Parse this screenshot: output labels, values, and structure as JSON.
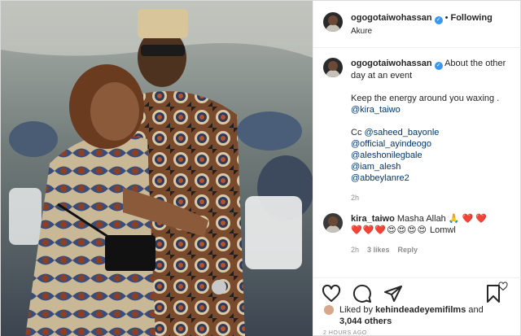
{
  "header": {
    "username": "ogogotaiwohassan",
    "separator": "•",
    "follow_label": "Following",
    "location": "Akure"
  },
  "caption": {
    "username": "ogogotaiwohassan",
    "line1": "About the other day at an event",
    "line2": "Keep the energy around you waxing .",
    "mention1": "@kira_taiwo",
    "cc_label": "Cc",
    "mentions": [
      "@saheed_bayonle",
      "@official_ayindeogo",
      "@aleshonilegbale",
      "@iam_alesh",
      "@abbeylanre2"
    ],
    "time": "2h"
  },
  "comment": {
    "username": "kira_taiwo",
    "text": "Masha Allah 🙏 ❤️ ❤️",
    "emoji_line": "❤️❤️❤️😍😍😍😍",
    "tail": "Lomwl",
    "time": "2h",
    "likes": "3 likes",
    "reply": "Reply"
  },
  "likes": {
    "prefix": "Liked by",
    "user": "kehindeadeyemifilms",
    "conj": "and",
    "count": "3,044 others"
  },
  "timestamp": "2 HOURS AGO",
  "icons": {
    "like": "heart-icon",
    "comment": "comment-icon",
    "share": "paper-plane-icon",
    "save": "bookmark-icon",
    "verified": "verified-badge-icon"
  },
  "colors": {
    "link": "#00376b",
    "verified": "#3897f0",
    "muted": "#8e8e8e"
  }
}
